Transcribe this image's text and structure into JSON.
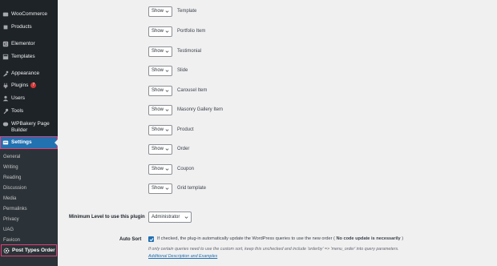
{
  "sidebar": {
    "items": [
      {
        "label": "WooCommerce",
        "icon": "woocommerce-icon"
      },
      {
        "label": "Products",
        "icon": "products-icon"
      },
      {
        "label": "Elementor",
        "icon": "elementor-icon"
      },
      {
        "label": "Templates",
        "icon": "templates-icon"
      },
      {
        "label": "Appearance",
        "icon": "appearance-icon"
      },
      {
        "label": "Plugins",
        "icon": "plugins-icon",
        "badge": "7"
      },
      {
        "label": "Users",
        "icon": "users-icon"
      },
      {
        "label": "Tools",
        "icon": "tools-icon"
      },
      {
        "label": "WPBakery Page Builder",
        "icon": "wpbakery-icon"
      },
      {
        "label": "Settings",
        "icon": "settings-icon"
      }
    ],
    "submenu": [
      "General",
      "Writing",
      "Reading",
      "Discussion",
      "Media",
      "Permalinks",
      "Privacy",
      "UAG",
      "Favicon"
    ],
    "post_types_order": "Post Types Order"
  },
  "main": {
    "rows": [
      {
        "value": "Show",
        "label": "Template"
      },
      {
        "value": "Show",
        "label": "Portfolio Item"
      },
      {
        "value": "Show",
        "label": "Testimonial"
      },
      {
        "value": "Show",
        "label": "Slide"
      },
      {
        "value": "Show",
        "label": "Carousel Item"
      },
      {
        "value": "Show",
        "label": "Masonry Gallery Item"
      },
      {
        "value": "Show",
        "label": "Product"
      },
      {
        "value": "Show",
        "label": "Order"
      },
      {
        "value": "Show",
        "label": "Coupon"
      },
      {
        "value": "Show",
        "label": "Grid template"
      }
    ],
    "min_level_label": "Minimum Level to use this plugin",
    "min_level_value": "Administrator",
    "auto_sort_label": "Auto Sort",
    "auto_sort_desc_before": "If checked, the plug-in automatically update the WordPress queries to use the new order (",
    "auto_sort_desc_bold": " No code update is necessarily ",
    "auto_sort_desc_after": ")",
    "auto_sort_note": "If only certain queries need to use the custom sort, keep this unchecked and include 'orderby' => 'menu_order' into query parameters.",
    "auto_sort_link": "Additional Description and Examples"
  },
  "colors": {
    "sidebar_bg": "#1d2327",
    "active_bg": "#2271b1",
    "highlight": "#e0407a",
    "badge": "#d63638"
  }
}
